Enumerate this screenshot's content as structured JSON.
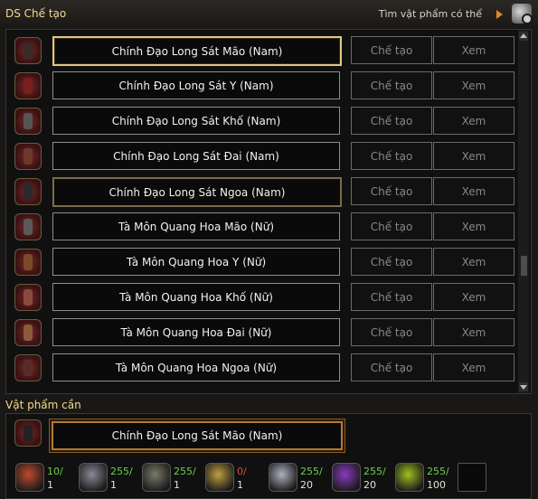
{
  "header": {
    "title": "DS Chế tạo",
    "find_label": "Tìm vật phẩm có thể"
  },
  "list": {
    "rows": [
      {
        "name": "Chính Đạo Long Sát Mão (Nam)",
        "craft": "Chế tạo",
        "view": "Xem",
        "state": "selected",
        "color": "#3a2a2a"
      },
      {
        "name": "Chính Đạo Long Sát Y (Nam)",
        "craft": "Chế tạo",
        "view": "Xem",
        "state": "normal",
        "color": "#7a1e1e"
      },
      {
        "name": "Chính Đạo Long Sát Khố (Nam)",
        "craft": "Chế tạo",
        "view": "Xem",
        "state": "normal",
        "color": "#555555"
      },
      {
        "name": "Chính Đạo Long Sát Đai (Nam)",
        "craft": "Chế tạo",
        "view": "Xem",
        "state": "normal",
        "color": "#6a3a2a"
      },
      {
        "name": "Chính Đạo Long Sát Ngoa (Nam)",
        "craft": "Chế tạo",
        "view": "Xem",
        "state": "hover",
        "color": "#2a2a2a"
      },
      {
        "name": "Tà Môn Quang Hoa Mão (Nữ)",
        "craft": "Chế tạo",
        "view": "Xem",
        "state": "normal",
        "color": "#5a5a5a"
      },
      {
        "name": "Tà Môn Quang Hoa Y (Nữ)",
        "craft": "Chế tạo",
        "view": "Xem",
        "state": "normal",
        "color": "#7a4a2a"
      },
      {
        "name": "Tà Môn Quang Hoa Khố (Nữ)",
        "craft": "Chế tạo",
        "view": "Xem",
        "state": "normal",
        "color": "#8a4a3a"
      },
      {
        "name": "Tà Môn Quang Hoa Đai (Nữ)",
        "craft": "Chế tạo",
        "view": "Xem",
        "state": "normal",
        "color": "#8a5a3a"
      },
      {
        "name": "Tà Môn Quang Hoa Ngoa (Nữ)",
        "craft": "Chế tạo",
        "view": "Xem",
        "state": "normal",
        "color": "#5a2a2a"
      }
    ]
  },
  "required": {
    "title": "Vật phẩm cần",
    "item_name": "Chính Đạo Long Sát Mão (Nam)",
    "materials": [
      {
        "have": "10/",
        "need": "1",
        "status": "ok",
        "icon": "scroll-icon",
        "color": "#c04a2a"
      },
      {
        "have": "255/",
        "need": "1",
        "status": "ok",
        "icon": "silver-orb-icon",
        "color": "#8a8a9a"
      },
      {
        "have": "255/",
        "need": "1",
        "status": "ok",
        "icon": "stone-orb-icon",
        "color": "#7a7a6a"
      },
      {
        "have": "0/",
        "need": "1",
        "status": "bad",
        "icon": "eye-gem-icon",
        "color": "#c0a040"
      },
      {
        "have": "255/",
        "need": "20",
        "status": "ok",
        "icon": "diamond-icon",
        "color": "#b0b0c0"
      },
      {
        "have": "255/",
        "need": "20",
        "status": "ok",
        "icon": "purple-crystal-icon",
        "color": "#8a3ac0"
      },
      {
        "have": "255/",
        "need": "100",
        "status": "ok",
        "icon": "green-gem-icon",
        "color": "#a0c020"
      }
    ]
  }
}
